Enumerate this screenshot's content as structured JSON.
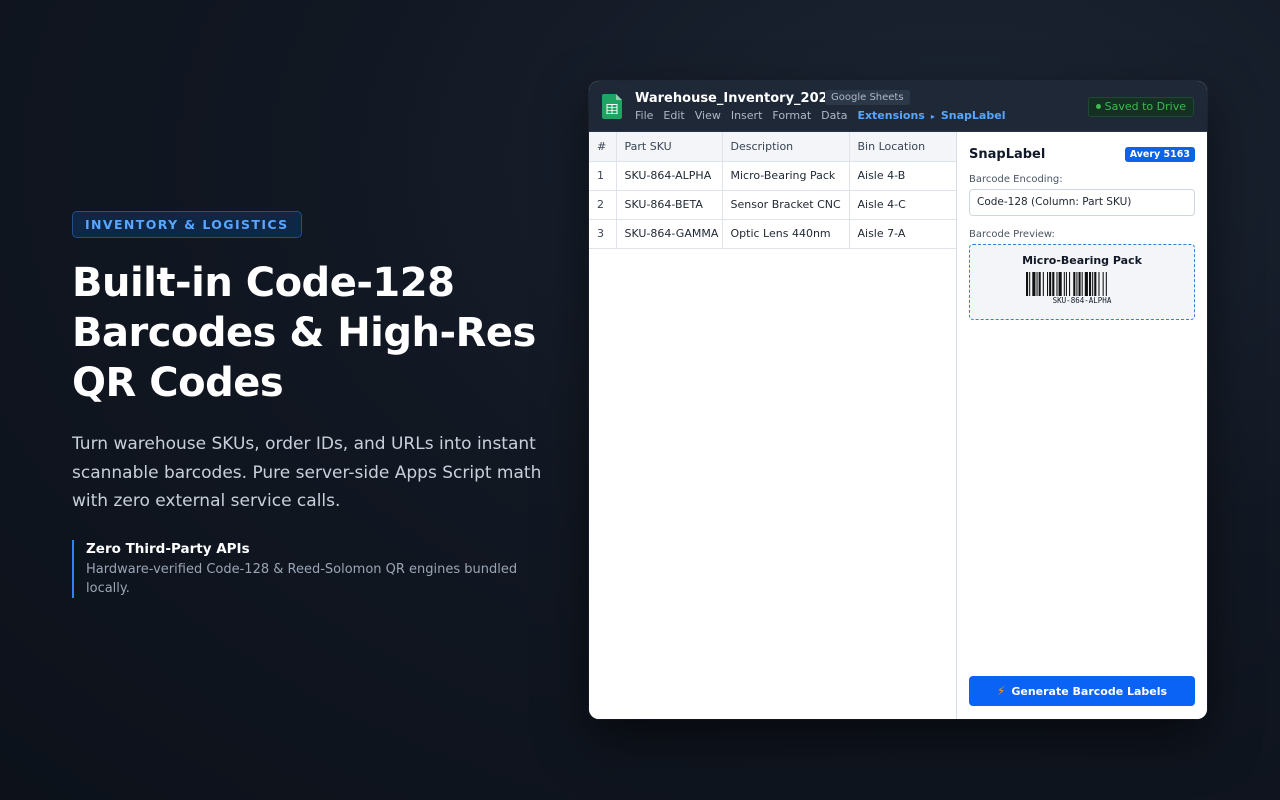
{
  "hero": {
    "eyebrow": "INVENTORY & LOGISTICS",
    "title_lines": [
      "Built-in Code-128",
      "Barcodes & High-Res",
      "QR Codes"
    ],
    "lede": "Turn warehouse SKUs, order IDs, and URLs into instant scannable barcodes. Pure server-side Apps Script math with zero external service calls.",
    "feature": {
      "title": "Zero Third-Party APIs",
      "desc": "Hardware-verified Code-128 & Reed-Solomon QR engines bundled locally."
    }
  },
  "window": {
    "doc_title": "Warehouse_Inventory_2026.xlsx",
    "app_chip": "Google Sheets",
    "menu": [
      "File",
      "Edit",
      "View",
      "Insert",
      "Format",
      "Data"
    ],
    "menu_extensions": "Extensions",
    "menu_separator": "▸",
    "menu_addon": "SnapLabel",
    "saved_status": "Saved to Drive"
  },
  "sheet": {
    "headers": [
      "#",
      "Part SKU",
      "Description",
      "Bin Location"
    ],
    "rows": [
      [
        "1",
        "SKU-864-ALPHA",
        "Micro-Bearing Pack",
        "Aisle 4-B"
      ],
      [
        "2",
        "SKU-864-BETA",
        "Sensor Bracket CNC",
        "Aisle 4-C"
      ],
      [
        "3",
        "SKU-864-GAMMA",
        "Optic Lens 440nm",
        "Aisle 7-A"
      ]
    ]
  },
  "panel": {
    "title": "SnapLabel",
    "badge": "Avery 5163",
    "encoding_label": "Barcode Encoding:",
    "encoding_value": "Code-128 (Column: Part SKU)",
    "preview_label": "Barcode Preview:",
    "preview_name": "Micro-Bearing Pack",
    "preview_code": "SKU-864-ALPHA",
    "button_label": "Generate Barcode Labels"
  },
  "colors": {
    "accent": "#0b63f6",
    "saved_green": "#3fb950",
    "eyebrow_blue": "#58a6ff"
  },
  "icons": {
    "app_icon": "google-sheets-icon",
    "button_icon": "lightning-icon",
    "saved_icon": "status-dot-icon"
  }
}
